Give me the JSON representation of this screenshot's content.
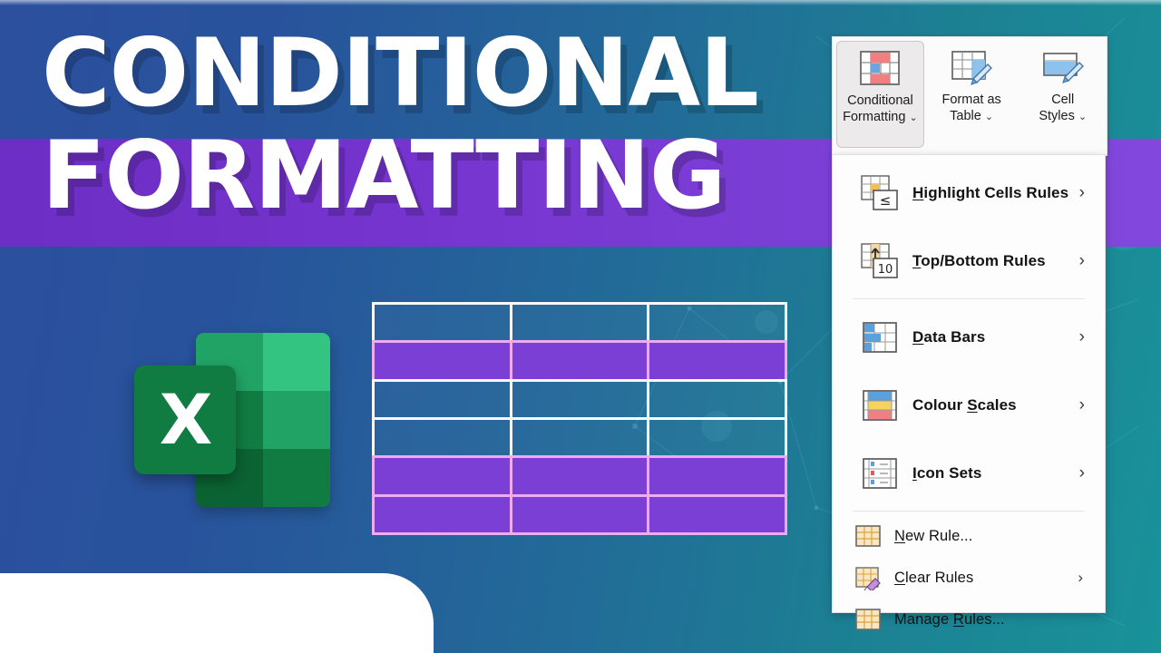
{
  "background": {
    "gradient_from": "#2c4f9e",
    "gradient_to": "#19929a",
    "band_color": "#7b3fd6",
    "white_corner_color": "#ffffff"
  },
  "title": {
    "line1": "CONDITIONAL",
    "line2": "FORMATTING",
    "text_color": "#ffffff"
  },
  "excel_logo": {
    "letter": "X",
    "doc_colors": [
      "#21a366",
      "#33c481",
      "#107c41",
      "#21a366",
      "#0b6333",
      "#107c41"
    ],
    "tile_color": "#107c41",
    "icon_name": "excel-logo"
  },
  "table_graphic": {
    "rows": 6,
    "columns": 3,
    "highlighted_rows": [
      2,
      5,
      6
    ],
    "highlight_fill": "#7b3fd6",
    "highlight_border": "#efaaf2",
    "plain_border": "#ffffff"
  },
  "ribbon": {
    "buttons": [
      {
        "label_line1": "Conditional",
        "label_line2": "Formatting",
        "has_caret": true,
        "active": true,
        "icon": "conditional-formatting-icon"
      },
      {
        "label_line1": "Format as",
        "label_line2": "Table",
        "has_caret": true,
        "active": false,
        "icon": "format-as-table-icon"
      },
      {
        "label_line1": "Cell",
        "label_line2": "Styles",
        "has_caret": true,
        "active": false,
        "icon": "cell-styles-icon"
      }
    ],
    "caret_glyph": "⌄"
  },
  "menu": {
    "arrow_glyph": "›",
    "groups": [
      {
        "items": [
          {
            "label": "Highlight Cells Rules",
            "accel": "H",
            "submenu": true,
            "icon": "highlight-cells-rules-icon"
          },
          {
            "label": "Top/Bottom Rules",
            "accel": "T",
            "submenu": true,
            "icon": "top-bottom-rules-icon"
          }
        ]
      },
      {
        "items": [
          {
            "label": "Data Bars",
            "accel": "D",
            "submenu": true,
            "icon": "data-bars-icon"
          },
          {
            "label": "Colour Scales",
            "accel": "S",
            "submenu": true,
            "icon": "colour-scales-icon"
          },
          {
            "label": "Icon Sets",
            "accel": "I",
            "submenu": true,
            "icon": "icon-sets-icon"
          }
        ]
      },
      {
        "items": [
          {
            "label": "New Rule...",
            "accel": "N",
            "submenu": false,
            "icon": "new-rule-icon"
          },
          {
            "label": "Clear Rules",
            "accel": "C",
            "submenu": true,
            "icon": "clear-rules-icon"
          },
          {
            "label": "Manage Rules...",
            "accel": "R",
            "submenu": false,
            "icon": "manage-rules-icon"
          }
        ]
      }
    ]
  }
}
